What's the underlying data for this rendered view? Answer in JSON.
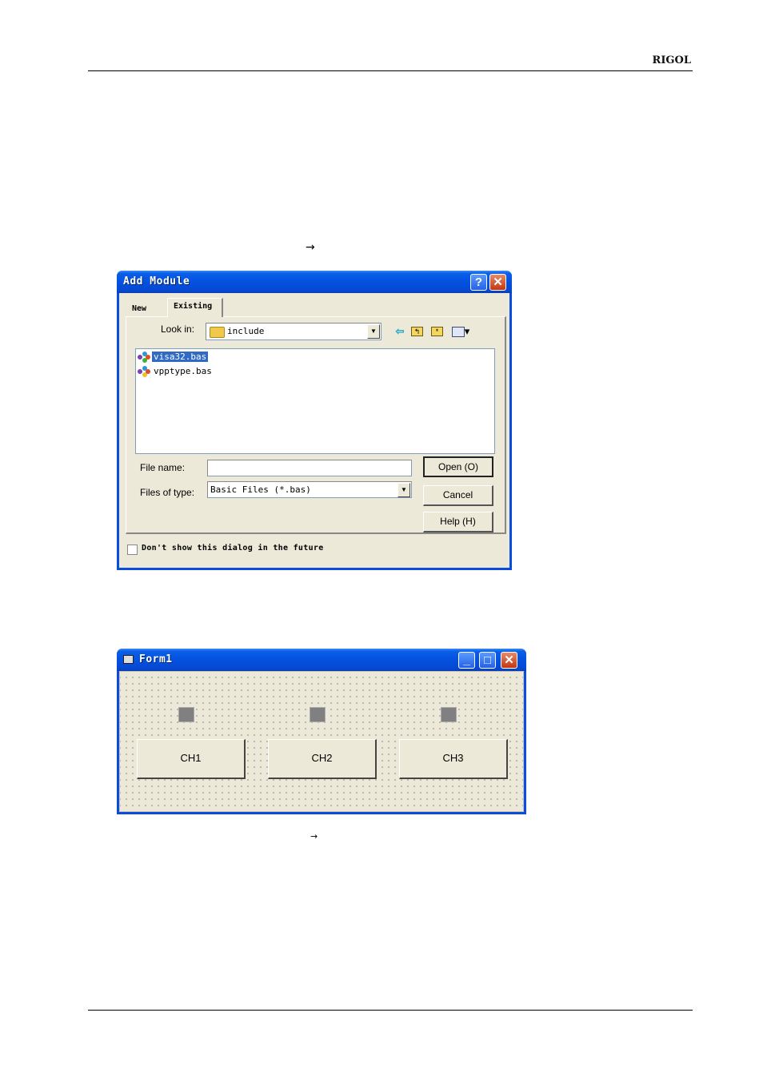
{
  "page": {
    "brand": "RIGOL",
    "arrow_1": "→",
    "arrow_2": "→"
  },
  "add_module_dialog": {
    "title": "Add Module",
    "title_buttons": {
      "help": "?",
      "close": "✕"
    },
    "tabs": [
      {
        "label": "New",
        "active": false
      },
      {
        "label": "Existing",
        "active": true
      }
    ],
    "look_in_label": "Look in:",
    "look_in_value": "include",
    "toolbar_icons": [
      "back-arrow-icon",
      "up-folder-icon",
      "new-folder-icon",
      "view-menu-icon"
    ],
    "files": [
      {
        "name": "visa32.bas",
        "selected": true
      },
      {
        "name": "vpptype.bas",
        "selected": false
      }
    ],
    "file_name_label": "File name:",
    "file_name_value": "",
    "files_of_type_label": "Files of type:",
    "files_of_type_value": "Basic Files (*.bas)",
    "buttons": {
      "open": "Open (O)",
      "cancel": "Cancel",
      "help": "Help (H)"
    },
    "checkbox_label": "Don't show this dialog in the future",
    "checkbox_checked": false
  },
  "form1": {
    "title": "Form1",
    "title_buttons": {
      "minimize": "_",
      "maximize": "□",
      "close": "✕"
    },
    "buttons": [
      "CH1",
      "CH2",
      "CH3"
    ]
  }
}
